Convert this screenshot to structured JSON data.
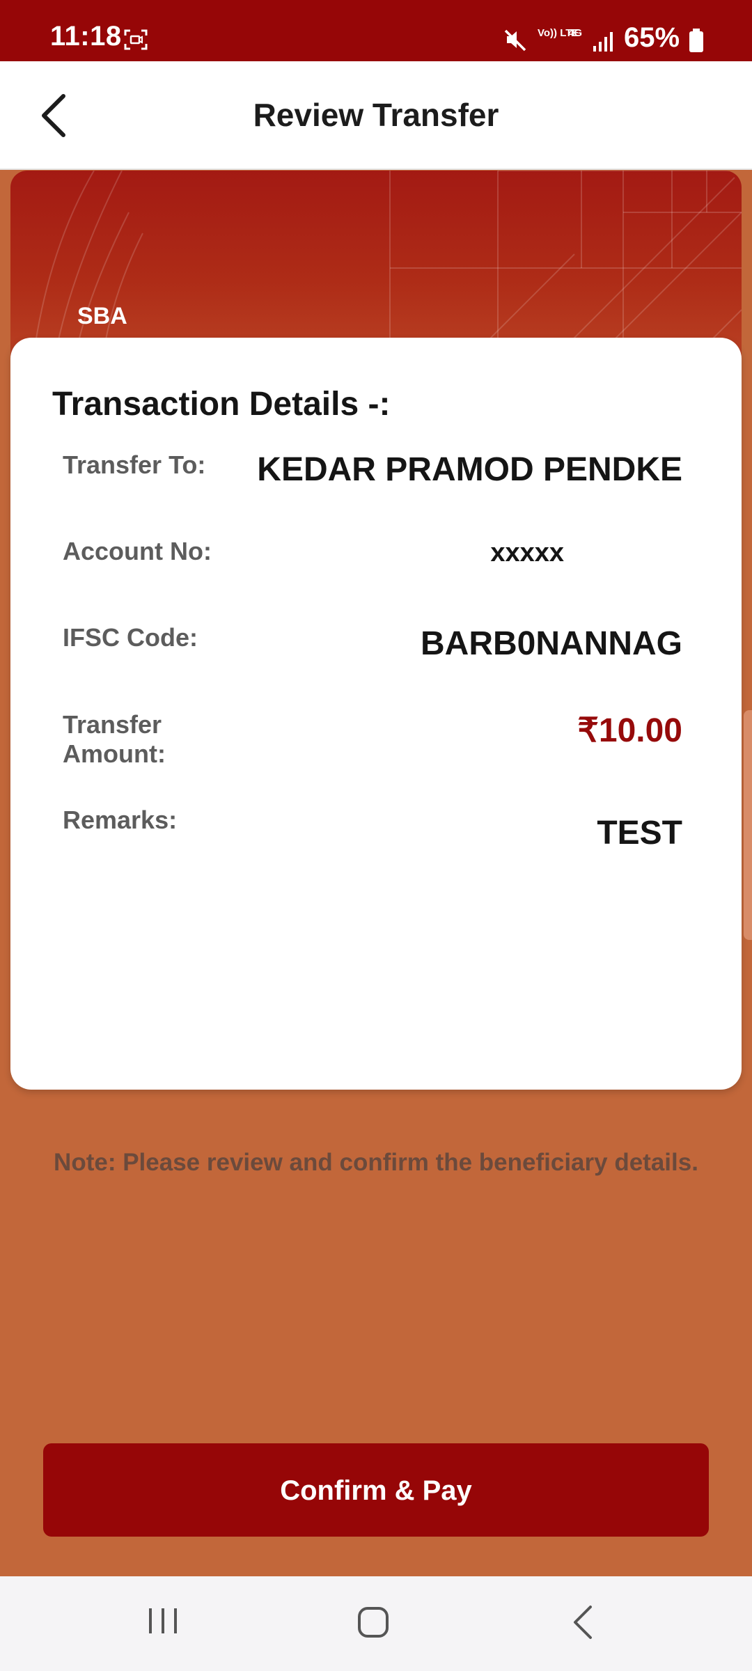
{
  "status_bar": {
    "time": "11:18",
    "volte_label": "Vo)) LTE",
    "network_label": "4G",
    "battery": "65%"
  },
  "header": {
    "title": "Review Transfer"
  },
  "account": {
    "type": "SBA"
  },
  "transaction": {
    "title": "Transaction Details -:",
    "transfer_to_label": "Transfer To:",
    "transfer_to_value": "KEDAR PRAMOD PENDKE",
    "account_no_label": "Account No:",
    "account_no_value": "xxxxx",
    "ifsc_label": "IFSC Code:",
    "ifsc_value": "BARB0NANNAG",
    "amount_label_line1": "Transfer",
    "amount_label_line2": "Amount:",
    "amount_value": "₹10.00",
    "remarks_label": "Remarks:",
    "remarks_value": "TEST"
  },
  "note": "Note: Please review and confirm the beneficiary details.",
  "confirm_button_label": "Confirm & Pay",
  "colors": {
    "brand": "#960607",
    "background": "#c2673a",
    "amount": "#960a0a"
  },
  "icons": {
    "back": "back-arrow-icon",
    "screenshot": "screen-capture-icon",
    "mute": "mute-icon",
    "signal": "signal-icon",
    "battery": "battery-icon",
    "nav_recents": "recents-icon",
    "nav_home": "home-icon",
    "nav_back": "nav-back-icon"
  }
}
